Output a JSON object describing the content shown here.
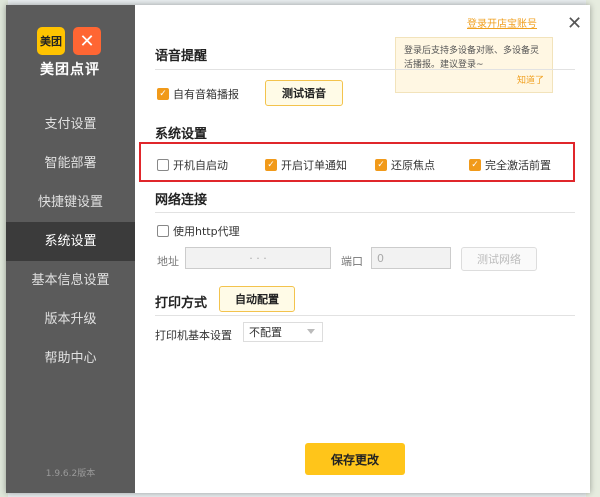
{
  "sidebar": {
    "logo_mt": "美团",
    "logo_dp": "✕",
    "logo_text": "美团点评",
    "items": [
      {
        "label": "支付设置"
      },
      {
        "label": "智能部署"
      },
      {
        "label": "快捷键设置"
      },
      {
        "label": "系统设置"
      },
      {
        "label": "基本信息设置"
      },
      {
        "label": "版本升级"
      },
      {
        "label": "帮助中心"
      }
    ],
    "version": "1.9.6.2版本"
  },
  "header": {
    "login_link": "登录开店宝账号",
    "close_icon": "✕",
    "tooltip_text": "登录后支持多设备对账、多设备灵活播报。建议登录~",
    "tooltip_dismiss": "知道了"
  },
  "voice": {
    "title": "语音提醒",
    "speaker_label": "自有音箱播报",
    "test_button": "测试语音"
  },
  "system": {
    "title": "系统设置",
    "options": [
      {
        "label": "开机自启动",
        "checked": false
      },
      {
        "label": "开启订单通知",
        "checked": true
      },
      {
        "label": "还原焦点",
        "checked": true
      },
      {
        "label": "完全激活前置",
        "checked": true
      }
    ]
  },
  "network": {
    "title": "网络连接",
    "proxy_label": "使用http代理",
    "address_label": "地址",
    "address_value": "·   ·   ·",
    "port_label": "端口",
    "port_value": "0",
    "test_button": "测试网络"
  },
  "print": {
    "title": "打印方式",
    "auto_button": "自动配置",
    "printer_label": "打印机基本设置",
    "printer_value": "不配置"
  },
  "save_button": "保存更改",
  "colors": {
    "accent": "#f19a1a",
    "button": "#ffc51a",
    "highlight": "#e0262b"
  }
}
